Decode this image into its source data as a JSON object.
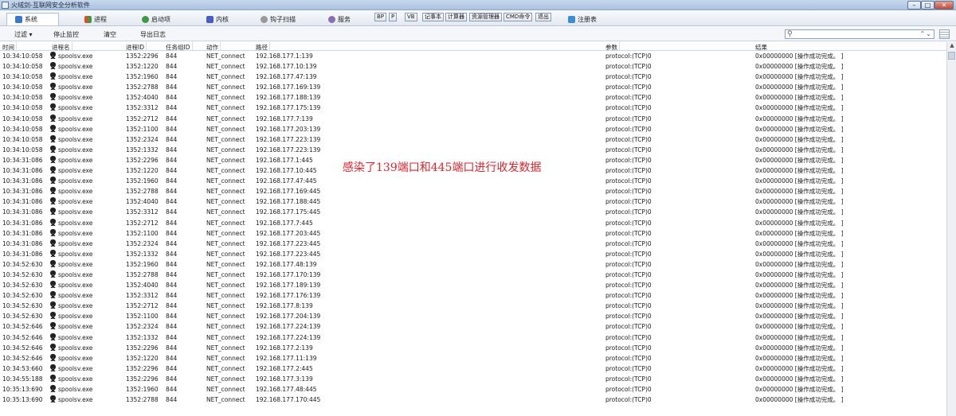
{
  "window": {
    "title": "火绒剑-互联网安全分析软件",
    "min": "–",
    "max": "□",
    "close": "✕"
  },
  "tabs": [
    {
      "label": "系统",
      "icon": "monitor-icon",
      "color": "#3a78c8"
    },
    {
      "label": "进程",
      "icon": "windows-icon",
      "color": "#e08a20"
    },
    {
      "label": "启动项",
      "icon": "startup-icon",
      "color": "#3f9a3f"
    },
    {
      "label": "内核",
      "icon": "kernel-icon",
      "color": "#4a5ec0"
    },
    {
      "label": "钩子扫描",
      "icon": "hook-icon",
      "color": "#777777"
    },
    {
      "label": "服务",
      "icon": "service-icon",
      "color": "#8a6fb0"
    },
    {
      "label": "注册表",
      "icon": "registry-icon",
      "color": "#3d8ed0"
    }
  ],
  "tool_buttons": [
    "BP",
    "P",
    "VB",
    "记事本",
    "计算器",
    "资源管理器",
    "CMD命令",
    "退出"
  ],
  "toolbar": {
    "filter": "过滤 ▾",
    "stop": "停止监控",
    "clear": "清空",
    "export": "导出日志"
  },
  "columns": [
    "时间",
    "进程名",
    "进程ID",
    "任务组ID",
    "动作",
    "路径",
    "参数",
    "结果"
  ],
  "overlay_text": "感染了139端口和445端口进行收发数据",
  "rows": [
    [
      "10:34:10:058",
      "spoolsv.exe",
      "1352:2296",
      "844",
      "NET_connect",
      "192.168.177.1:139",
      "protocol:(TCP)0",
      "0x00000000 [操作成功完成。 ]"
    ],
    [
      "10:34:10:058",
      "spoolsv.exe",
      "1352:1220",
      "844",
      "NET_connect",
      "192.168.177.10:139",
      "protocol:(TCP)0",
      "0x00000000 [操作成功完成。 ]"
    ],
    [
      "10:34:10:058",
      "spoolsv.exe",
      "1352:1960",
      "844",
      "NET_connect",
      "192.168.177.47:139",
      "protocol:(TCP)0",
      "0x00000000 [操作成功完成。 ]"
    ],
    [
      "10:34:10:058",
      "spoolsv.exe",
      "1352:2788",
      "844",
      "NET_connect",
      "192.168.177.169:139",
      "protocol:(TCP)0",
      "0x00000000 [操作成功完成。 ]"
    ],
    [
      "10:34:10:058",
      "spoolsv.exe",
      "1352:4040",
      "844",
      "NET_connect",
      "192.168.177.188:139",
      "protocol:(TCP)0",
      "0x00000000 [操作成功完成。 ]"
    ],
    [
      "10:34:10:058",
      "spoolsv.exe",
      "1352:3312",
      "844",
      "NET_connect",
      "192.168.177.175:139",
      "protocol:(TCP)0",
      "0x00000000 [操作成功完成。 ]"
    ],
    [
      "10:34:10:058",
      "spoolsv.exe",
      "1352:2712",
      "844",
      "NET_connect",
      "192.168.177.7:139",
      "protocol:(TCP)0",
      "0x00000000 [操作成功完成。 ]"
    ],
    [
      "10:34:10:058",
      "spoolsv.exe",
      "1352:1100",
      "844",
      "NET_connect",
      "192.168.177.203:139",
      "protocol:(TCP)0",
      "0x00000000 [操作成功完成。 ]"
    ],
    [
      "10:34:10:058",
      "spoolsv.exe",
      "1352:2324",
      "844",
      "NET_connect",
      "192.168.177.223:139",
      "protocol:(TCP)0",
      "0x00000000 [操作成功完成。 ]"
    ],
    [
      "10:34:10:058",
      "spoolsv.exe",
      "1352:1332",
      "844",
      "NET_connect",
      "192.168.177.223:139",
      "protocol:(TCP)0",
      "0x00000000 [操作成功完成。 ]"
    ],
    [
      "10:34:31:086",
      "spoolsv.exe",
      "1352:2296",
      "844",
      "NET_connect",
      "192.168.177.1:445",
      "protocol:(TCP)0",
      "0x00000000 [操作成功完成。 ]"
    ],
    [
      "10:34:31:086",
      "spoolsv.exe",
      "1352:1220",
      "844",
      "NET_connect",
      "192.168.177.10:445",
      "protocol:(TCP)0",
      "0x00000000 [操作成功完成。 ]"
    ],
    [
      "10:34:31:086",
      "spoolsv.exe",
      "1352:1960",
      "844",
      "NET_connect",
      "192.168.177.47:445",
      "protocol:(TCP)0",
      "0x00000000 [操作成功完成。 ]"
    ],
    [
      "10:34:31:086",
      "spoolsv.exe",
      "1352:2788",
      "844",
      "NET_connect",
      "192.168.177.169:445",
      "protocol:(TCP)0",
      "0x00000000 [操作成功完成。 ]"
    ],
    [
      "10:34:31:086",
      "spoolsv.exe",
      "1352:4040",
      "844",
      "NET_connect",
      "192.168.177.188:445",
      "protocol:(TCP)0",
      "0x00000000 [操作成功完成。 ]"
    ],
    [
      "10:34:31:086",
      "spoolsv.exe",
      "1352:3312",
      "844",
      "NET_connect",
      "192.168.177.175:445",
      "protocol:(TCP)0",
      "0x00000000 [操作成功完成。 ]"
    ],
    [
      "10:34:31:086",
      "spoolsv.exe",
      "1352:2712",
      "844",
      "NET_connect",
      "192.168.177.7:445",
      "protocol:(TCP)0",
      "0x00000000 [操作成功完成。 ]"
    ],
    [
      "10:34:31:086",
      "spoolsv.exe",
      "1352:1100",
      "844",
      "NET_connect",
      "192.168.177.203:445",
      "protocol:(TCP)0",
      "0x00000000 [操作成功完成。 ]"
    ],
    [
      "10:34:31:086",
      "spoolsv.exe",
      "1352:2324",
      "844",
      "NET_connect",
      "192.168.177.223:445",
      "protocol:(TCP)0",
      "0x00000000 [操作成功完成。 ]"
    ],
    [
      "10:34:31:086",
      "spoolsv.exe",
      "1352:1332",
      "844",
      "NET_connect",
      "192.168.177.223:445",
      "protocol:(TCP)0",
      "0x00000000 [操作成功完成。 ]"
    ],
    [
      "10:34:52:630",
      "spoolsv.exe",
      "1352:1960",
      "844",
      "NET_connect",
      "192.168.177.48:139",
      "protocol:(TCP)0",
      "0x00000000 [操作成功完成。 ]"
    ],
    [
      "10:34:52:630",
      "spoolsv.exe",
      "1352:2788",
      "844",
      "NET_connect",
      "192.168.177.170:139",
      "protocol:(TCP)0",
      "0x00000000 [操作成功完成。 ]"
    ],
    [
      "10:34:52:630",
      "spoolsv.exe",
      "1352:4040",
      "844",
      "NET_connect",
      "192.168.177.189:139",
      "protocol:(TCP)0",
      "0x00000000 [操作成功完成。 ]"
    ],
    [
      "10:34:52:630",
      "spoolsv.exe",
      "1352:3312",
      "844",
      "NET_connect",
      "192.168.177.176:139",
      "protocol:(TCP)0",
      "0x00000000 [操作成功完成。 ]"
    ],
    [
      "10:34:52:630",
      "spoolsv.exe",
      "1352:2712",
      "844",
      "NET_connect",
      "192.168.177.8:139",
      "protocol:(TCP)0",
      "0x00000000 [操作成功完成。 ]"
    ],
    [
      "10:34:52:630",
      "spoolsv.exe",
      "1352:1100",
      "844",
      "NET_connect",
      "192.168.177.204:139",
      "protocol:(TCP)0",
      "0x00000000 [操作成功完成。 ]"
    ],
    [
      "10:34:52:646",
      "spoolsv.exe",
      "1352:2324",
      "844",
      "NET_connect",
      "192.168.177.224:139",
      "protocol:(TCP)0",
      "0x00000000 [操作成功完成。 ]"
    ],
    [
      "10:34:52:646",
      "spoolsv.exe",
      "1352:1332",
      "844",
      "NET_connect",
      "192.168.177.224:139",
      "protocol:(TCP)0",
      "0x00000000 [操作成功完成。 ]"
    ],
    [
      "10:34:52:646",
      "spoolsv.exe",
      "1352:2296",
      "844",
      "NET_connect",
      "192.168.177.2:139",
      "protocol:(TCP)0",
      "0x00000000 [操作成功完成。 ]"
    ],
    [
      "10:34:52:646",
      "spoolsv.exe",
      "1352:1220",
      "844",
      "NET_connect",
      "192.168.177.11:139",
      "protocol:(TCP)0",
      "0x00000000 [操作成功完成。 ]"
    ],
    [
      "10:34:53:660",
      "spoolsv.exe",
      "1352:2296",
      "844",
      "NET_connect",
      "192.168.177.2:445",
      "protocol:(TCP)0",
      "0x00000000 [操作成功完成。 ]"
    ],
    [
      "10:34:55:188",
      "spoolsv.exe",
      "1352:2296",
      "844",
      "NET_connect",
      "192.168.177.3:139",
      "protocol:(TCP)0",
      "0x00000000 [操作成功完成。 ]"
    ],
    [
      "10:35:13:690",
      "spoolsv.exe",
      "1352:1960",
      "844",
      "NET_connect",
      "192.168.177.48:445",
      "protocol:(TCP)0",
      "0x00000000 [操作成功完成。 ]"
    ],
    [
      "10:35:13:690",
      "spoolsv.exe",
      "1352:2788",
      "844",
      "NET_connect",
      "192.168.177.170:445",
      "protocol:(TCP)0",
      "0x00000000 [操作成功完成。 ]"
    ]
  ]
}
